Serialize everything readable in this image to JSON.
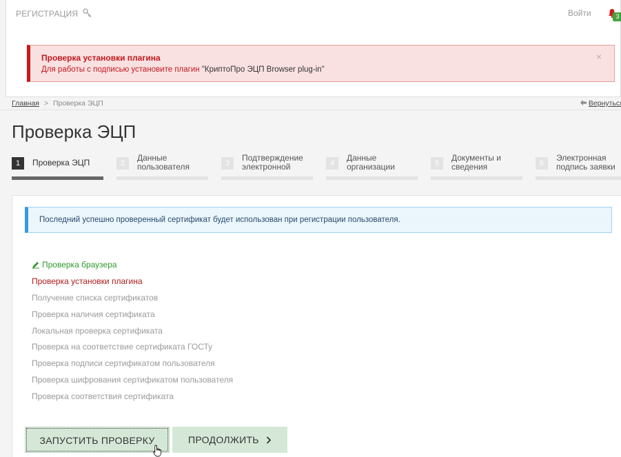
{
  "header": {
    "brand": "РЕГИСТРАЦИЯ",
    "login": "Войти",
    "notification_count": "3"
  },
  "alert": {
    "title": "Проверка установки плагина",
    "text": "Для работы с подписью установите плагин",
    "plugin_name": "\"КриптоПро ЭЦП Browser plug-in\"",
    "close": "×"
  },
  "breadcrumb": {
    "home": "Главная",
    "separator": ">",
    "current": "Проверка ЭЦП",
    "back": "Вернуться"
  },
  "page_title": "Проверка ЭЦП",
  "steps": [
    {
      "num": "1",
      "line1": "Проверка ЭЦП",
      "line2": ""
    },
    {
      "num": "2",
      "line1": "Данные",
      "line2": "пользователя"
    },
    {
      "num": "3",
      "line1": "Подтверждение",
      "line2": "электронной"
    },
    {
      "num": "4",
      "line1": "Данные",
      "line2": "организации"
    },
    {
      "num": "5",
      "line1": "Документы и",
      "line2": "сведения"
    },
    {
      "num": "6",
      "line1": "Электронная",
      "line2": "подпись заявки"
    }
  ],
  "info": "Последний успешно проверенный сертификат будет использован при регистрации пользователя.",
  "checks": [
    {
      "label": "Проверка браузера",
      "status": "ok"
    },
    {
      "label": "Проверка установки плагина",
      "status": "error"
    },
    {
      "label": "Получение списка сертификатов",
      "status": "pending"
    },
    {
      "label": "Проверка наличия сертификата",
      "status": "pending"
    },
    {
      "label": "Локальная проверка сертификата",
      "status": "pending"
    },
    {
      "label": "Проверка на соответствие сертификата ГОСТу",
      "status": "pending"
    },
    {
      "label": "Проверка подписи сертификатом пользователя",
      "status": "pending"
    },
    {
      "label": "Проверка шифрования сертификатом пользователя",
      "status": "pending"
    },
    {
      "label": "Проверка соответствия сертификата",
      "status": "pending"
    }
  ],
  "buttons": {
    "start": "ЗАПУСТИТЬ ПРОВЕРКУ",
    "continue": "ПРОДОЛЖИТЬ"
  },
  "colors": {
    "alert_red": "#c0191e",
    "ok_green": "#2e9a2e",
    "info_blue": "#3a9ad9",
    "button_green": "#d5e8d7"
  }
}
